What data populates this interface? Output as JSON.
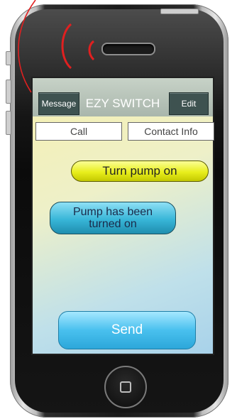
{
  "screen": {
    "navbar": {
      "left_button": "Message",
      "title": "EZY SWITCH",
      "right_button": "Edit"
    },
    "segments": {
      "call": "Call",
      "contact_info": "Contact Info"
    },
    "messages": {
      "outgoing": "Turn pump on",
      "incoming_line1": "Pump has been",
      "incoming_line2": "turned on"
    },
    "send_button": "Send"
  },
  "colors": {
    "navbar_button": "#3e5250",
    "outgoing_bubble": "#e8ee1c",
    "incoming_bubble": "#38b6d8",
    "send_button": "#49c0ee",
    "signal_arc": "#e02020"
  },
  "icons": {
    "signal": "signal-arcs-icon",
    "home": "home-square-icon"
  }
}
